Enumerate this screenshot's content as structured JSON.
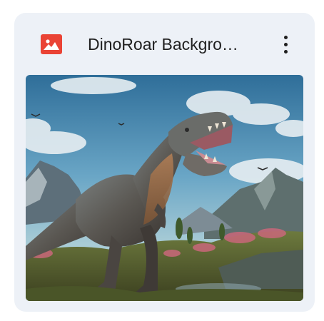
{
  "file": {
    "title": "DinoRoar Backgro…",
    "type_icon": "image-icon",
    "type_color": "#ea4335",
    "menu_icon": "more-vert-icon"
  },
  "thumbnail": {
    "subject": "tyrannosaurus-illustration"
  }
}
